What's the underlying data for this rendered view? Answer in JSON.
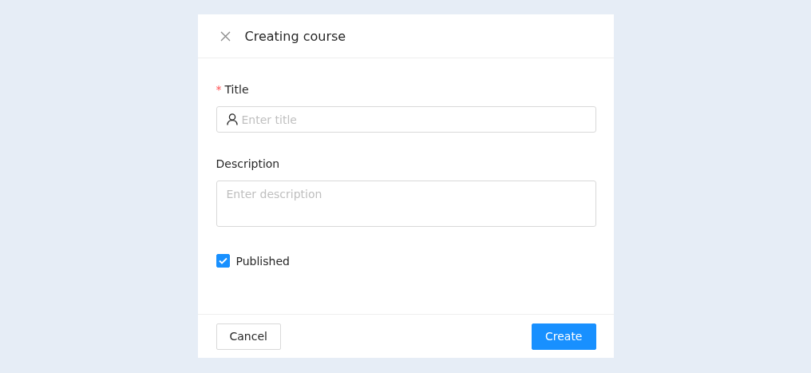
{
  "dialog": {
    "title": "Creating course"
  },
  "fields": [
    {
      "kind": "input",
      "label": "Title",
      "required_mark": "*",
      "placeholder": "Enter title"
    },
    {
      "kind": "textarea",
      "label": "Description",
      "placeholder": "Enter description"
    }
  ],
  "published": {
    "label": "Published",
    "checked": true
  },
  "buttons": [
    {
      "kind": "default",
      "label": "Cancel"
    },
    {
      "kind": "primary",
      "label": "Create"
    }
  ]
}
